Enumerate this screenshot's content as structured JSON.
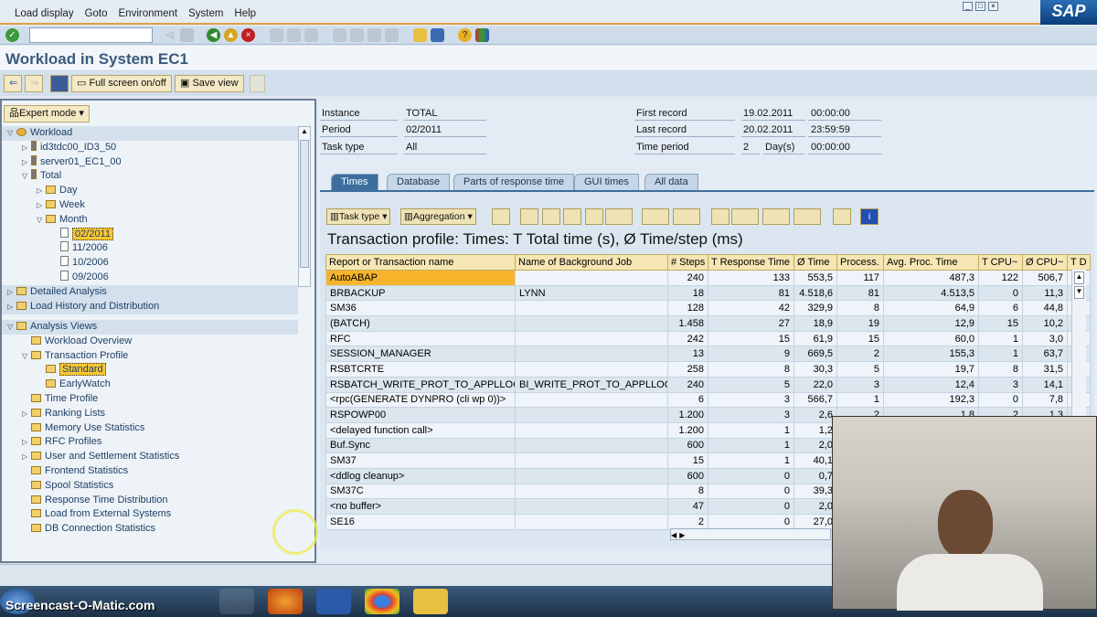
{
  "menu": {
    "items": [
      "Load display",
      "Goto",
      "Environment",
      "System",
      "Help"
    ],
    "logo": "SAP"
  },
  "title": "Workload in System EC1",
  "app_toolbar": {
    "fullscreen": "Full screen on/off",
    "save_view": "Save view"
  },
  "left": {
    "expert_mode": "Expert mode",
    "tree": [
      {
        "label": "Workload",
        "level": 0,
        "icon": "person-icon",
        "expanded": true,
        "section": true
      },
      {
        "label": "id3tdc00_ID3_50",
        "level": 1,
        "icon": "server-icon"
      },
      {
        "label": "server01_EC1_00",
        "level": 1,
        "icon": "server-icon"
      },
      {
        "label": "Total",
        "level": 1,
        "icon": "server-icon",
        "expanded": true
      },
      {
        "label": "Day",
        "level": 2,
        "icon": "folder-icon"
      },
      {
        "label": "Week",
        "level": 2,
        "icon": "folder-icon"
      },
      {
        "label": "Month",
        "level": 2,
        "icon": "folder-icon",
        "expanded": true
      },
      {
        "label": "02/2011",
        "level": 3,
        "icon": "document-icon",
        "selected": true
      },
      {
        "label": "11/2006",
        "level": 3,
        "icon": "document-icon"
      },
      {
        "label": "10/2006",
        "level": 3,
        "icon": "document-icon"
      },
      {
        "label": "09/2006",
        "level": 3,
        "icon": "document-icon"
      }
    ],
    "sections": [
      "Detailed Analysis",
      "Load History and Distribution"
    ],
    "analysis": [
      {
        "label": "Analysis Views",
        "level": 0,
        "expanded": true,
        "section": true
      },
      {
        "label": "Workload Overview",
        "level": 1
      },
      {
        "label": "Transaction Profile",
        "level": 1,
        "expanded": true
      },
      {
        "label": "Standard",
        "level": 2,
        "selected": true
      },
      {
        "label": "EarlyWatch",
        "level": 2
      },
      {
        "label": "Time Profile",
        "level": 1
      },
      {
        "label": "Ranking Lists",
        "level": 1,
        "folder": true
      },
      {
        "label": "Memory Use Statistics",
        "level": 1
      },
      {
        "label": "RFC Profiles",
        "level": 1,
        "folder": true
      },
      {
        "label": "User and Settlement Statistics",
        "level": 1,
        "folder": true
      },
      {
        "label": "Frontend Statistics",
        "level": 1
      },
      {
        "label": "Spool Statistics",
        "level": 1
      },
      {
        "label": "Response Time Distribution",
        "level": 1
      },
      {
        "label": "Load from External Systems",
        "level": 1
      },
      {
        "label": "DB Connection Statistics",
        "level": 1
      }
    ]
  },
  "header": {
    "instance_label": "Instance",
    "instance": "TOTAL",
    "period_label": "Period",
    "period": "02/2011",
    "tasktype_label": "Task type",
    "tasktype": "All",
    "first_label": "First record",
    "first_date": "19.02.2011",
    "first_time": "00:00:00",
    "last_label": "Last record",
    "last_date": "20.02.2011",
    "last_time": "23:59:59",
    "tp_label": "Time period",
    "tp_value": "2",
    "tp_unit": "Day(s)",
    "tp_time": "00:00:00"
  },
  "tabs": [
    "Times",
    "Database",
    "Parts of response time",
    "GUI times",
    "All data"
  ],
  "alv_toolbar": {
    "task_type": "Task type",
    "aggregation": "Aggregation"
  },
  "report_title": "Transaction profile: Times: T Total time (s), Ø Time/step (ms)",
  "table": {
    "columns": [
      "Report or Transaction name",
      "Name of Background Job",
      "# Steps",
      "T Response Time",
      "Ø Time",
      "Process.",
      "Avg. Proc. Time",
      "T CPU~",
      "Ø CPU~",
      "T D"
    ],
    "rows": [
      [
        "AutoABAP",
        "",
        "240",
        "133",
        "553,5",
        "117",
        "487,3",
        "122",
        "506,7",
        ""
      ],
      [
        "BRBACKUP",
        "LYNN",
        "18",
        "81",
        "4.518,6",
        "81",
        "4.513,5",
        "0",
        "11,3",
        ""
      ],
      [
        "SM36",
        "",
        "128",
        "42",
        "329,9",
        "8",
        "64,9",
        "6",
        "44,8",
        ""
      ],
      [
        "(BATCH)",
        "",
        "1.458",
        "27",
        "18,9",
        "19",
        "12,9",
        "15",
        "10,2",
        ""
      ],
      [
        "RFC",
        "",
        "242",
        "15",
        "61,9",
        "15",
        "60,0",
        "1",
        "3,0",
        ""
      ],
      [
        "SESSION_MANAGER",
        "",
        "13",
        "9",
        "669,5",
        "2",
        "155,3",
        "1",
        "63,7",
        ""
      ],
      [
        "RSBTCRTE",
        "",
        "258",
        "8",
        "30,3",
        "5",
        "19,7",
        "8",
        "31,5",
        ""
      ],
      [
        "RSBATCH_WRITE_PROT_TO_APPLLOG",
        "BI_WRITE_PROT_TO_APPLLOG",
        "240",
        "5",
        "22,0",
        "3",
        "12,4",
        "3",
        "14,1",
        ""
      ],
      [
        "<rpc(GENERATE DYNPRO (cli wp 0))>",
        "",
        "6",
        "3",
        "566,7",
        "1",
        "192,3",
        "0",
        "7,8",
        ""
      ],
      [
        "RSPOWP00",
        "",
        "1.200",
        "3",
        "2,6",
        "2",
        "1,8",
        "2",
        "1,3",
        ""
      ],
      [
        "<delayed function call>",
        "",
        "1.200",
        "1",
        "1,2",
        "",
        "",
        "",
        "",
        ""
      ],
      [
        "Buf.Sync",
        "",
        "600",
        "1",
        "2,0",
        "",
        "",
        "",
        "",
        ""
      ],
      [
        "SM37",
        "",
        "15",
        "1",
        "40,1",
        "",
        "",
        "",
        "",
        ""
      ],
      [
        "<ddlog cleanup>",
        "",
        "600",
        "0",
        "0,7",
        "",
        "",
        "",
        "",
        ""
      ],
      [
        "SM37C",
        "",
        "8",
        "0",
        "39,3",
        "",
        "",
        "",
        "",
        ""
      ],
      [
        "<no buffer>",
        "",
        "47",
        "0",
        "2,0",
        "",
        "",
        "",
        "",
        ""
      ],
      [
        "SE16",
        "",
        "2",
        "0",
        "27,0",
        "",
        "",
        "",
        "",
        ""
      ]
    ]
  },
  "watermark": "Screencast-O-Matic.com"
}
